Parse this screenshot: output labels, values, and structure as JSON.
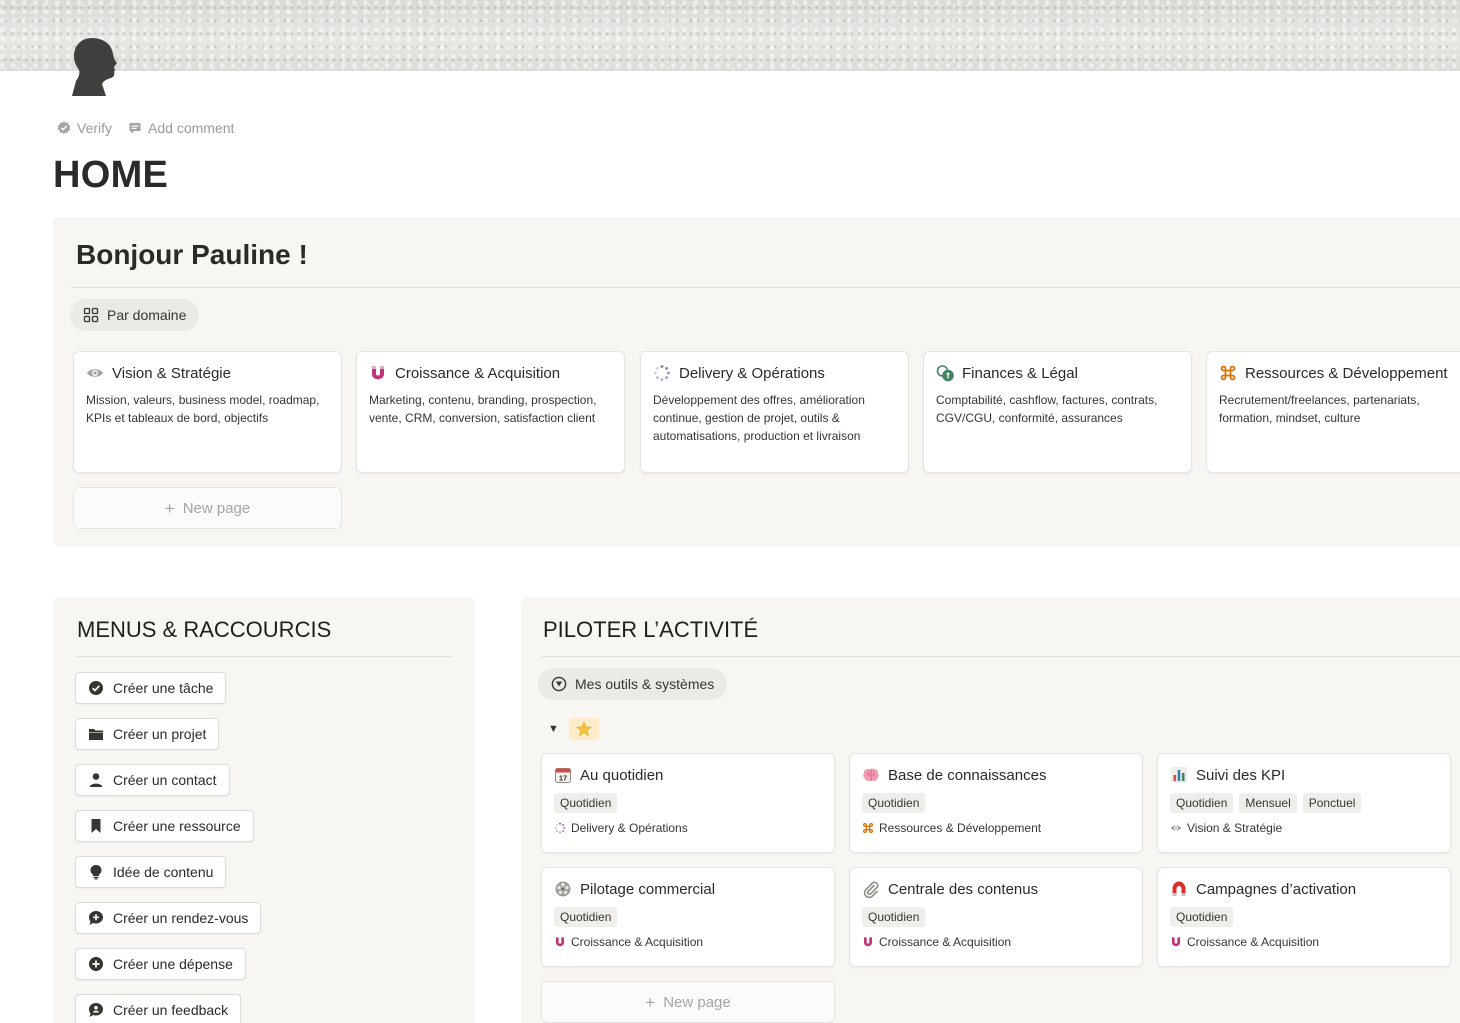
{
  "meta": {
    "verify": "Verify",
    "add_comment": "Add comment"
  },
  "page": {
    "title": "HOME"
  },
  "greeting": {
    "title": "Bonjour Pauline !",
    "view_tab": "Par domaine",
    "domains": [
      {
        "icon": "eye-icon",
        "title": "Vision & Stratégie",
        "desc": "Mission, valeurs, business model, roadmap, KPIs et tableaux de bord, objectifs"
      },
      {
        "icon": "magnet-icon",
        "title": "Croissance & Acquisition",
        "desc": "Marketing, contenu, branding, prospection, vente, CRM, conversion, satisfaction client"
      },
      {
        "icon": "loading-icon",
        "title": "Delivery & Opérations",
        "desc": "Développement des offres, amélioration continue, gestion de projet, outils & automatisations, production et livraison"
      },
      {
        "icon": "coins-icon",
        "title": "Finances & Légal",
        "desc": "Comptabilité, cashflow, factures, contrats, CGV/CGU, conformité, assurances"
      },
      {
        "icon": "command-icon",
        "title": "Ressources & Développement",
        "desc": "Recrutement/freelances, partenariats, formation, mindset, culture"
      }
    ],
    "new_page": "New page"
  },
  "menus": {
    "title": "MENUS & RACCOURCIS",
    "buttons": [
      {
        "icon": "check-circle-icon",
        "label": "Créer une tâche"
      },
      {
        "icon": "folder-icon",
        "label": "Créer un projet"
      },
      {
        "icon": "person-icon",
        "label": "Créer un contact"
      },
      {
        "icon": "bookmark-icon",
        "label": "Créer une ressource"
      },
      {
        "icon": "lightbulb-icon",
        "label": "Idée de contenu"
      },
      {
        "icon": "chat-plus-icon",
        "label": "Créer un rendez-vous"
      },
      {
        "icon": "plus-circle-icon",
        "label": "Créer une dépense"
      },
      {
        "icon": "chat-person-icon",
        "label": "Créer un feedback"
      }
    ]
  },
  "pilot": {
    "title": "PILOTER L’ACTIVITÉ",
    "view_tab": "Mes outils & systèmes",
    "toggle_icon": "star-icon",
    "tools": [
      {
        "icon": "calendar-icon",
        "title": "Au quotidien",
        "tags": [
          "Quotidien"
        ],
        "relation_icon": "loading-icon",
        "relation": "Delivery & Opérations"
      },
      {
        "icon": "brain-icon",
        "title": "Base de connaissances",
        "tags": [
          "Quotidien"
        ],
        "relation_icon": "command-icon",
        "relation": "Ressources & Développement"
      },
      {
        "icon": "bar-chart-icon",
        "title": "Suivi des KPI",
        "tags": [
          "Quotidien",
          "Mensuel",
          "Ponctuel"
        ],
        "relation_icon": "eye-icon",
        "relation": "Vision & Stratégie"
      },
      {
        "icon": "film-reel-icon",
        "title": "Pilotage commercial",
        "tags": [
          "Quotidien"
        ],
        "relation_icon": "magnet-icon",
        "relation": "Croissance & Acquisition"
      },
      {
        "icon": "paperclip-icon",
        "title": "Centrale des contenus",
        "tags": [
          "Quotidien"
        ],
        "relation_icon": "magnet-icon",
        "relation": "Croissance & Acquisition"
      },
      {
        "icon": "red-magnet-icon",
        "title": "Campagnes d’activation",
        "tags": [
          "Quotidien"
        ],
        "relation_icon": "magnet-icon",
        "relation": "Croissance & Acquisition"
      }
    ],
    "new_page": "New page"
  },
  "colors": {
    "magnet": "#c0357a",
    "loading": "#9065b0",
    "command": "#d9730d",
    "coins": "#448361",
    "eye": "#9b9a97"
  }
}
